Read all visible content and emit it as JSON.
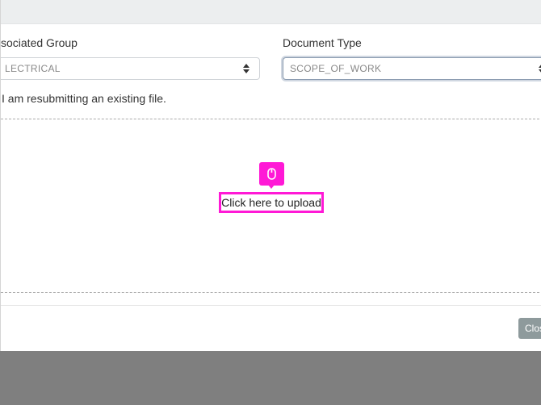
{
  "form": {
    "group_label": "sociated Group",
    "group_value": "LECTRICAL",
    "doctype_label": "Document Type",
    "doctype_value": "SCOPE_OF_WORK",
    "resubmit_label": "I am resubmitting an existing file."
  },
  "upload": {
    "prompt": "Click here to upload",
    "cursor_icon": "mouse-icon",
    "highlight_color": "#ff19d6"
  },
  "footer": {
    "close_label": "Clos"
  }
}
